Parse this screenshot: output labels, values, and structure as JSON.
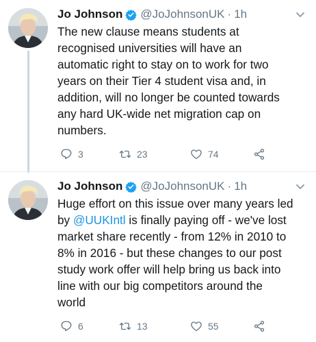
{
  "tweets": [
    {
      "name": "Jo Johnson",
      "handle": "@JoJohnsonUK",
      "separator": "·",
      "time": "1h",
      "text_lines": [
        "The new clause means students at",
        "recognised universities will have an",
        "automatic right to stay on to work for two",
        "years on their Tier 4 student visa and, in",
        "addition, will no longer be counted towards",
        "any hard UK-wide net migration cap on",
        "numbers."
      ],
      "replies": "3",
      "retweets": "23",
      "likes": "74"
    },
    {
      "name": "Jo Johnson",
      "handle": "@JoJohnsonUK",
      "separator": "·",
      "time": "1h",
      "text_line1": "Huge effort on this issue over many years led",
      "text_line2_before": "by ",
      "mention": "@UUKIntl",
      "text_line2_after": " is finally paying off - we've lost",
      "text_lines_rest": [
        "market share recently - from 12% in 2010 to",
        "8% in 2016 - but these changes to our post",
        "study work offer will help bring us back into",
        "line with our big competitors around the",
        "world"
      ],
      "replies": "6",
      "retweets": "13",
      "likes": "55"
    }
  ],
  "icons": {
    "verified": "verified-badge-icon",
    "reply": "reply-icon",
    "retweet": "retweet-icon",
    "like": "like-icon",
    "share": "share-icon",
    "menu": "chevron-down-icon"
  },
  "colors": {
    "text": "#14171a",
    "secondary": "#657786",
    "link": "#1b95e0",
    "verified": "#1da1f2"
  }
}
